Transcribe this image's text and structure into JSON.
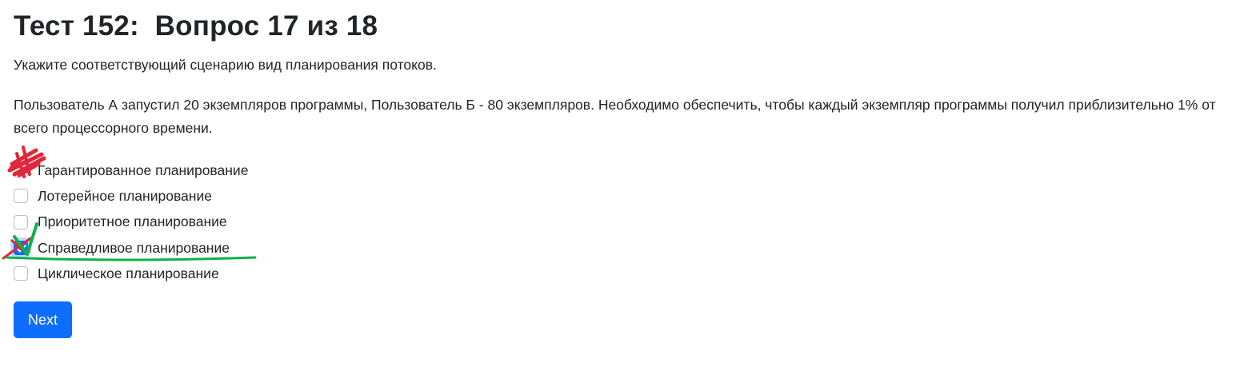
{
  "header": {
    "title": "Тест 152:  Вопрос 17 из 18"
  },
  "question": {
    "instruction": "Укажите соответствующий сценарию вид планирования потоков.",
    "scenario": "Пользователь А запустил 20 экземпляров программы, Пользователь Б - 80 экземпляров. Необходимо обеспечить, чтобы каждый экземпляр программы получил приблизительно 1% от всего процессорного времени."
  },
  "options": [
    {
      "label": "Гарантированное планирование",
      "checked": false
    },
    {
      "label": "Лотерейное планирование",
      "checked": false
    },
    {
      "label": "Приоритетное планирование",
      "checked": false
    },
    {
      "label": "Справедливое планирование",
      "checked": true
    },
    {
      "label": "Циклическое планирование",
      "checked": false
    }
  ],
  "actions": {
    "next_label": "Next"
  },
  "colors": {
    "primary": "#0d6efd",
    "text": "#212529",
    "annotation_red": "#e0283a",
    "annotation_green": "#10b04a"
  }
}
